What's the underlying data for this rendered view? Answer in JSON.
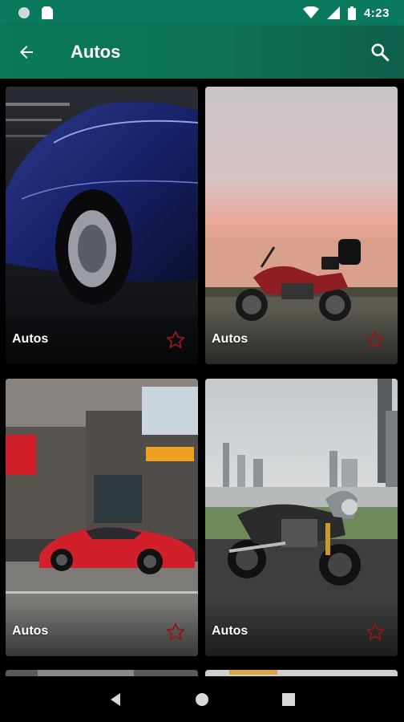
{
  "status_bar": {
    "time": "4:23",
    "icons": [
      "circle-notification-icon",
      "sim-card-icon",
      "wifi-icon",
      "cell-signal-icon",
      "battery-icon"
    ]
  },
  "app_bar": {
    "title": "Autos",
    "back_icon": "arrow-left-icon",
    "search_icon": "search-icon"
  },
  "grid": {
    "items": [
      {
        "label": "Autos",
        "subject": "blue sports car",
        "fav_icon": "star-outline-icon"
      },
      {
        "label": "Autos",
        "subject": "red motorcycle at sunset",
        "fav_icon": "star-outline-icon"
      },
      {
        "label": "Autos",
        "subject": "red sports car in city",
        "fav_icon": "star-outline-icon"
      },
      {
        "label": "Autos",
        "subject": "cafe racer motorcycle with skyline",
        "fav_icon": "star-outline-icon"
      },
      {
        "label": "",
        "subject": "partial card",
        "fav_icon": ""
      },
      {
        "label": "",
        "subject": "partial card",
        "fav_icon": ""
      }
    ]
  },
  "nav_bar": {
    "buttons": [
      "nav-back-icon",
      "nav-home-icon",
      "nav-recents-icon"
    ]
  },
  "colors": {
    "app_bar": "#0b7a5c",
    "star": "#8b1a1a",
    "background": "#000000"
  }
}
